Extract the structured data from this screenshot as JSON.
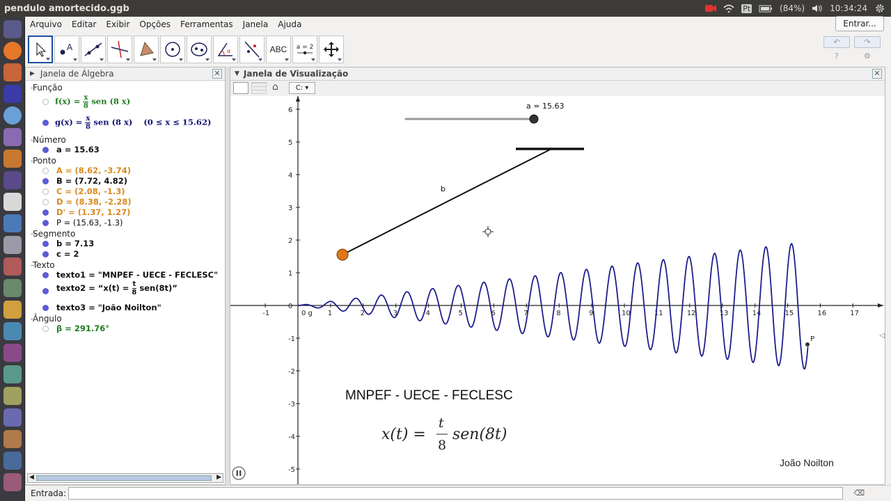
{
  "window": {
    "title": "pendulo amortecido.ggb"
  },
  "tray": {
    "battery": "(84%)",
    "time": "10:34:24",
    "lang": "Pt"
  },
  "menu": [
    "Arquivo",
    "Editar",
    "Exibir",
    "Opções",
    "Ferramentas",
    "Janela",
    "Ajuda"
  ],
  "login_label": "Entrar...",
  "toolbar": {
    "text_tool": "ABC",
    "slider_tool": "a = 2"
  },
  "algebra": {
    "title": "Janela de Álgebra",
    "categories": [
      "Função",
      "Número",
      "Ponto",
      "Segmento",
      "Texto",
      "Ângulo"
    ],
    "f_prefix": "f(x) =",
    "f_num": "x",
    "f_den": "8",
    "f_suffix": "sen (8 x)",
    "g_prefix": "g(x) =",
    "g_num": "x",
    "g_den": "8",
    "g_suffix": "sen (8 x)",
    "g_domain": "(0 ≤ x ≤ 15.62)",
    "items": [
      "a = 15.63",
      "A = (8.62, -3.74)",
      "B = (7.72, 4.82)",
      "C = (2.08, -1.3)",
      "D = (8.38, -2.28)",
      "D' = (1.37, 1.27)",
      "P = (15.63, -1.3)",
      "b = 7.13",
      "c = 2",
      "texto1 = \"MNPEF - UECE - FECLESC\"",
      "texto3 = \"João Noilton\"",
      "β = 291.76°"
    ],
    "texto2_prefix": "texto2 = “x(t) =",
    "texto2_num": "t",
    "texto2_den": "8",
    "texto2_suffix": "sen(8t)”",
    "colors": {
      "green": "#1e7a1e",
      "orange": "#d98a1e",
      "black": "#111111",
      "navy": "#111177",
      "blue": "#5b5bd6"
    }
  },
  "graphics": {
    "title": "Janela de Visualização",
    "slider_label": "a = 15.63",
    "segment_label": "b",
    "point_label": "P",
    "origin_label": "0 g",
    "text1": "MNPEF - UECE - FECLESC",
    "formula_lhs": "x(t) =",
    "formula_num": "t",
    "formula_den": "8",
    "formula_rhs": "sen(8t)",
    "author": "João Noilton",
    "x_ticks": [
      "-1",
      "1",
      "2",
      "3",
      "4",
      "5",
      "6",
      "7",
      "8",
      "9",
      "10",
      "11",
      "12",
      "13",
      "14",
      "15",
      "16",
      "17"
    ],
    "y_ticks": [
      "6",
      "5",
      "4",
      "3",
      "2",
      "1",
      "0",
      "-1",
      "-2",
      "-3",
      "-4",
      "-5"
    ],
    "colors": {
      "curve": "#1e1e8c",
      "bob": "#e07818",
      "axis": "#222222"
    }
  },
  "input": {
    "label": "Entrada:",
    "value": ""
  }
}
